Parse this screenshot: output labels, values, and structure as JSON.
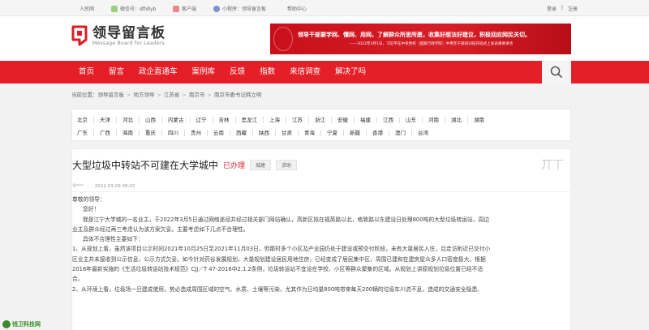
{
  "topbar": {
    "site": "人民网",
    "wechat": "微信号：dfldlyb",
    "client": "客户端",
    "miniapp": "小程序：领导留言板",
    "help": "帮助中心",
    "login": "登录",
    "sep": "|",
    "register": "注册"
  },
  "header": {
    "logo_cn": "领导留言板",
    "logo_en": "Message Board for Leaders",
    "banner_line1": "领导干部要学网、懂网、用网，了解群众所思所愿，收集好想法好建议，积极回应网民关切。",
    "banner_line2": "——2022年3月1日，习近平在中央党校（国家行政学院）中青年干部培训班开班式上发表重要讲话"
  },
  "nav": {
    "items": [
      "首页",
      "留言",
      "政企直通车",
      "案例库",
      "反馈",
      "指数",
      "来信调查",
      "解决了吗"
    ]
  },
  "breadcrumb": {
    "prefix": "当前位置：",
    "items": [
      "领导留言板",
      "地方领导",
      "江苏省",
      "南京市",
      "南京市委书记韩立明"
    ]
  },
  "regions": {
    "row1": [
      "北京",
      "天津",
      "河北",
      "山西",
      "内蒙古",
      "辽宁",
      "吉林",
      "黑龙江",
      "上海",
      "江苏",
      "浙江",
      "安徽",
      "福建",
      "江西",
      "山东",
      "河南",
      "湖北",
      "湖南"
    ],
    "row2": [
      "广东",
      "广西",
      "海南",
      "重庆",
      "四川",
      "贵州",
      "云南",
      "西藏",
      "陕西",
      "甘肃",
      "青海",
      "宁夏",
      "新疆",
      "香港",
      "澳门",
      "台湾"
    ]
  },
  "article": {
    "title": "大型垃圾中转站不可建在大学城中",
    "status": "已办理",
    "tags": [
      "城建",
      "求助"
    ],
    "corner_text": "丌丅",
    "author": "令***",
    "date": "2022-03-09 08:02",
    "greeting": "尊敬的领导：",
    "hello": "您好！",
    "p1a": "我是江宁大学城的一名业主，于2022年3月5日通过网络途径并经过相关部门网站确认，高新区拟在福英路以北，格致路以东建设日处理800吨的大型垃圾转运站，周边",
    "p1b": "业主及群众经过再三考虑认为该方案欠妥。主要考虑如下几点不合理性。",
    "p2": "具体不合理性主要如下：",
    "p3a": "1、从规划上看，虽然该项目公示时间2021年10月25日至2021年11月03日，但那时多个小区及产业园仍处于建设或预交付阶段，未有大量居民入住，且走访附近已交付小",
    "p3b": "区业主并未接收到公示信息，公示方式欠妥。如今针对药谷发展规划，大量规划建设居民用地住房，已经变成了居民集中区，周围已建和在建房屋众多人口密度极大。根据",
    "p3c": "2016年最新实施的《生活垃圾转运站技术规范》CJJ／T 47-2016中2.1.2条例，垃圾转运站不宜设在学校、小区等群众聚集的区域。从规划上讲原规划垃圾位置已经不适",
    "p3d": "合。",
    "p4": "2、从环境上看，垃圾场一旦建成使用，势必造成周围区域的空气、水质、土壤等污染，尤其作为日均量800吨带来每天200辆的垃圾车川流不息，造成的交通安全隐患、"
  },
  "watermark": "钱卫科技网"
}
